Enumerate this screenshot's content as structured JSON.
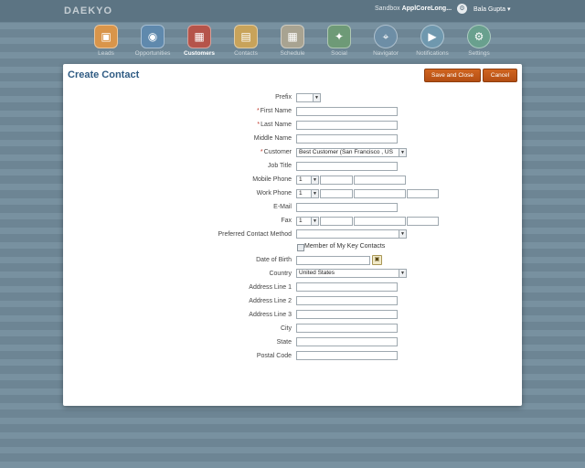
{
  "header": {
    "logo": "DAEKYO",
    "sandbox_prefix": "Sandbox",
    "sandbox_name": "ApplCoreLong...",
    "user": "Bala Gupta ▾"
  },
  "nav": [
    {
      "label": "Leads",
      "icon": "leads-icon",
      "glyph": "▣",
      "color": "#d9954a"
    },
    {
      "label": "Opportunities",
      "icon": "opportunities-icon",
      "glyph": "◉",
      "color": "#5f89ad"
    },
    {
      "label": "Customers",
      "icon": "customers-icon",
      "glyph": "▦",
      "color": "#b5544a",
      "active": true
    },
    {
      "label": "Contacts",
      "icon": "contacts-icon",
      "glyph": "▤",
      "color": "#c8a35a"
    },
    {
      "label": "Schedule",
      "icon": "schedule-icon",
      "glyph": "▦",
      "color": "#a8a391"
    },
    {
      "label": "Social",
      "icon": "social-icon",
      "glyph": "✦",
      "color": "#6e9a77"
    },
    {
      "label": "Navigator",
      "icon": "compass-icon",
      "glyph": "⌖",
      "color": "#6d8ea6",
      "round": true
    },
    {
      "label": "Notifications",
      "icon": "notifications-icon",
      "glyph": "▶",
      "color": "#6f98ae",
      "round": true
    },
    {
      "label": "Settings",
      "icon": "gear-icon",
      "glyph": "⚙",
      "color": "#69a08e",
      "round": true
    }
  ],
  "page": {
    "title": "Create Contact",
    "save_close": "Save and Close",
    "cancel": "Cancel"
  },
  "form": {
    "prefix": "Prefix",
    "first_name": "First Name",
    "last_name": "Last Name",
    "middle_name": "Middle Name",
    "customer": "Customer",
    "customer_value": "Best Customer (San Francisco , US",
    "job_title": "Job Title",
    "mobile_phone": "Mobile Phone",
    "work_phone": "Work Phone",
    "email": "E-Mail",
    "fax": "Fax",
    "country_code": "1",
    "preferred_contact": "Preferred Contact Method",
    "key_contacts": "Member of My Key Contacts",
    "dob": "Date of Birth",
    "country": "Country",
    "country_value": "United States",
    "address1": "Address Line 1",
    "address2": "Address Line 2",
    "address3": "Address Line 3",
    "city": "City",
    "state": "State",
    "postal": "Postal Code"
  },
  "colors": {
    "accent": "#c0561a",
    "title": "#2f5b83"
  }
}
